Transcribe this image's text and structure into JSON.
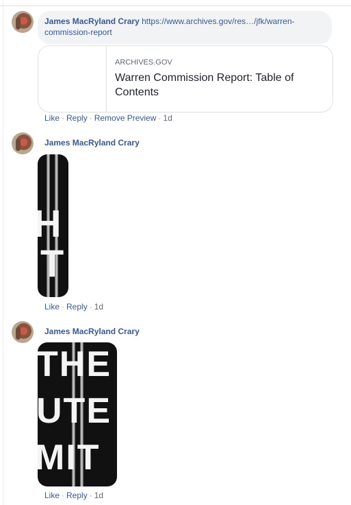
{
  "comments": [
    {
      "author": "James MacRyland Crary",
      "link_text": "https://www.archives.gov/res…/jfk/warren-commission-report",
      "preview": {
        "domain": "ARCHIVES.GOV",
        "title": "Warren Commission Report: Table of Contents"
      },
      "actions": {
        "like": "Like",
        "reply": "Reply",
        "remove_preview": "Remove Preview",
        "time": "1d"
      }
    },
    {
      "author": "James MacRyland Crary",
      "gif": {
        "lines": [
          "H",
          "T"
        ]
      },
      "actions": {
        "like": "Like",
        "reply": "Reply",
        "time": "1d"
      }
    },
    {
      "author": "James MacRyland Crary",
      "gif": {
        "lines": [
          "THE",
          "UTE",
          "MIT"
        ]
      },
      "actions": {
        "like": "Like",
        "reply": "Reply",
        "time": "1d"
      }
    }
  ]
}
